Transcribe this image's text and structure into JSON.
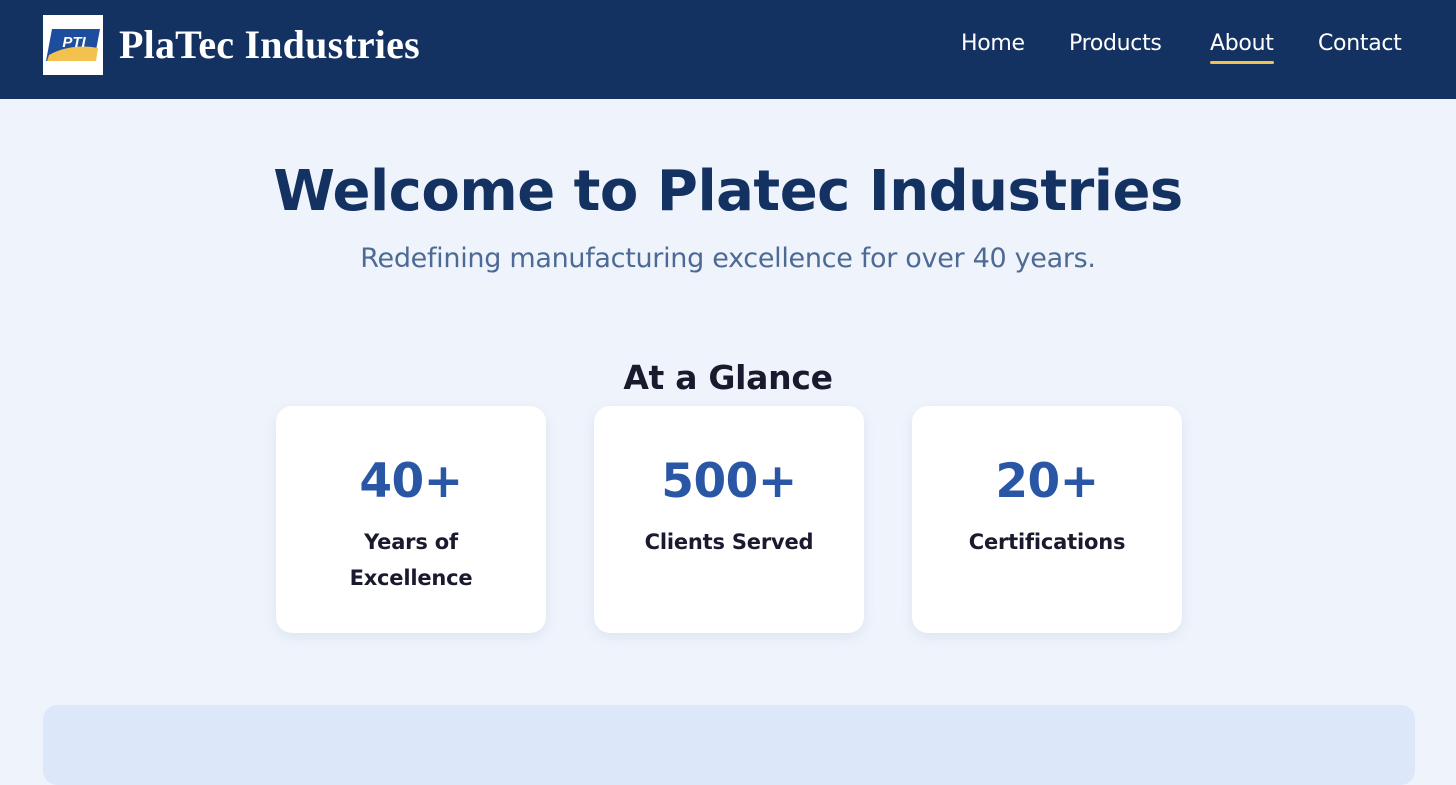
{
  "header": {
    "logo_text": "PTI",
    "brand_name": "PlaTec Industries",
    "nav": [
      {
        "label": "Home",
        "active": false
      },
      {
        "label": "Products",
        "active": false
      },
      {
        "label": "About",
        "active": true
      },
      {
        "label": "Contact",
        "active": false
      }
    ]
  },
  "hero": {
    "title": "Welcome to Platec Industries",
    "subtitle": "Redefining manufacturing excellence for over 40 years."
  },
  "glance": {
    "title": "At a Glance",
    "stats": [
      {
        "value": "40+",
        "label": "Years of Excellence"
      },
      {
        "value": "500+",
        "label": "Clients Served"
      },
      {
        "value": "20+",
        "label": "Certifications"
      }
    ]
  },
  "colors": {
    "header_bg": "#133262",
    "accent_underline": "#f2c14e",
    "page_bg": "#eff4fc",
    "stat_number": "#2a56a6",
    "panel_bg": "#dce8fa"
  }
}
